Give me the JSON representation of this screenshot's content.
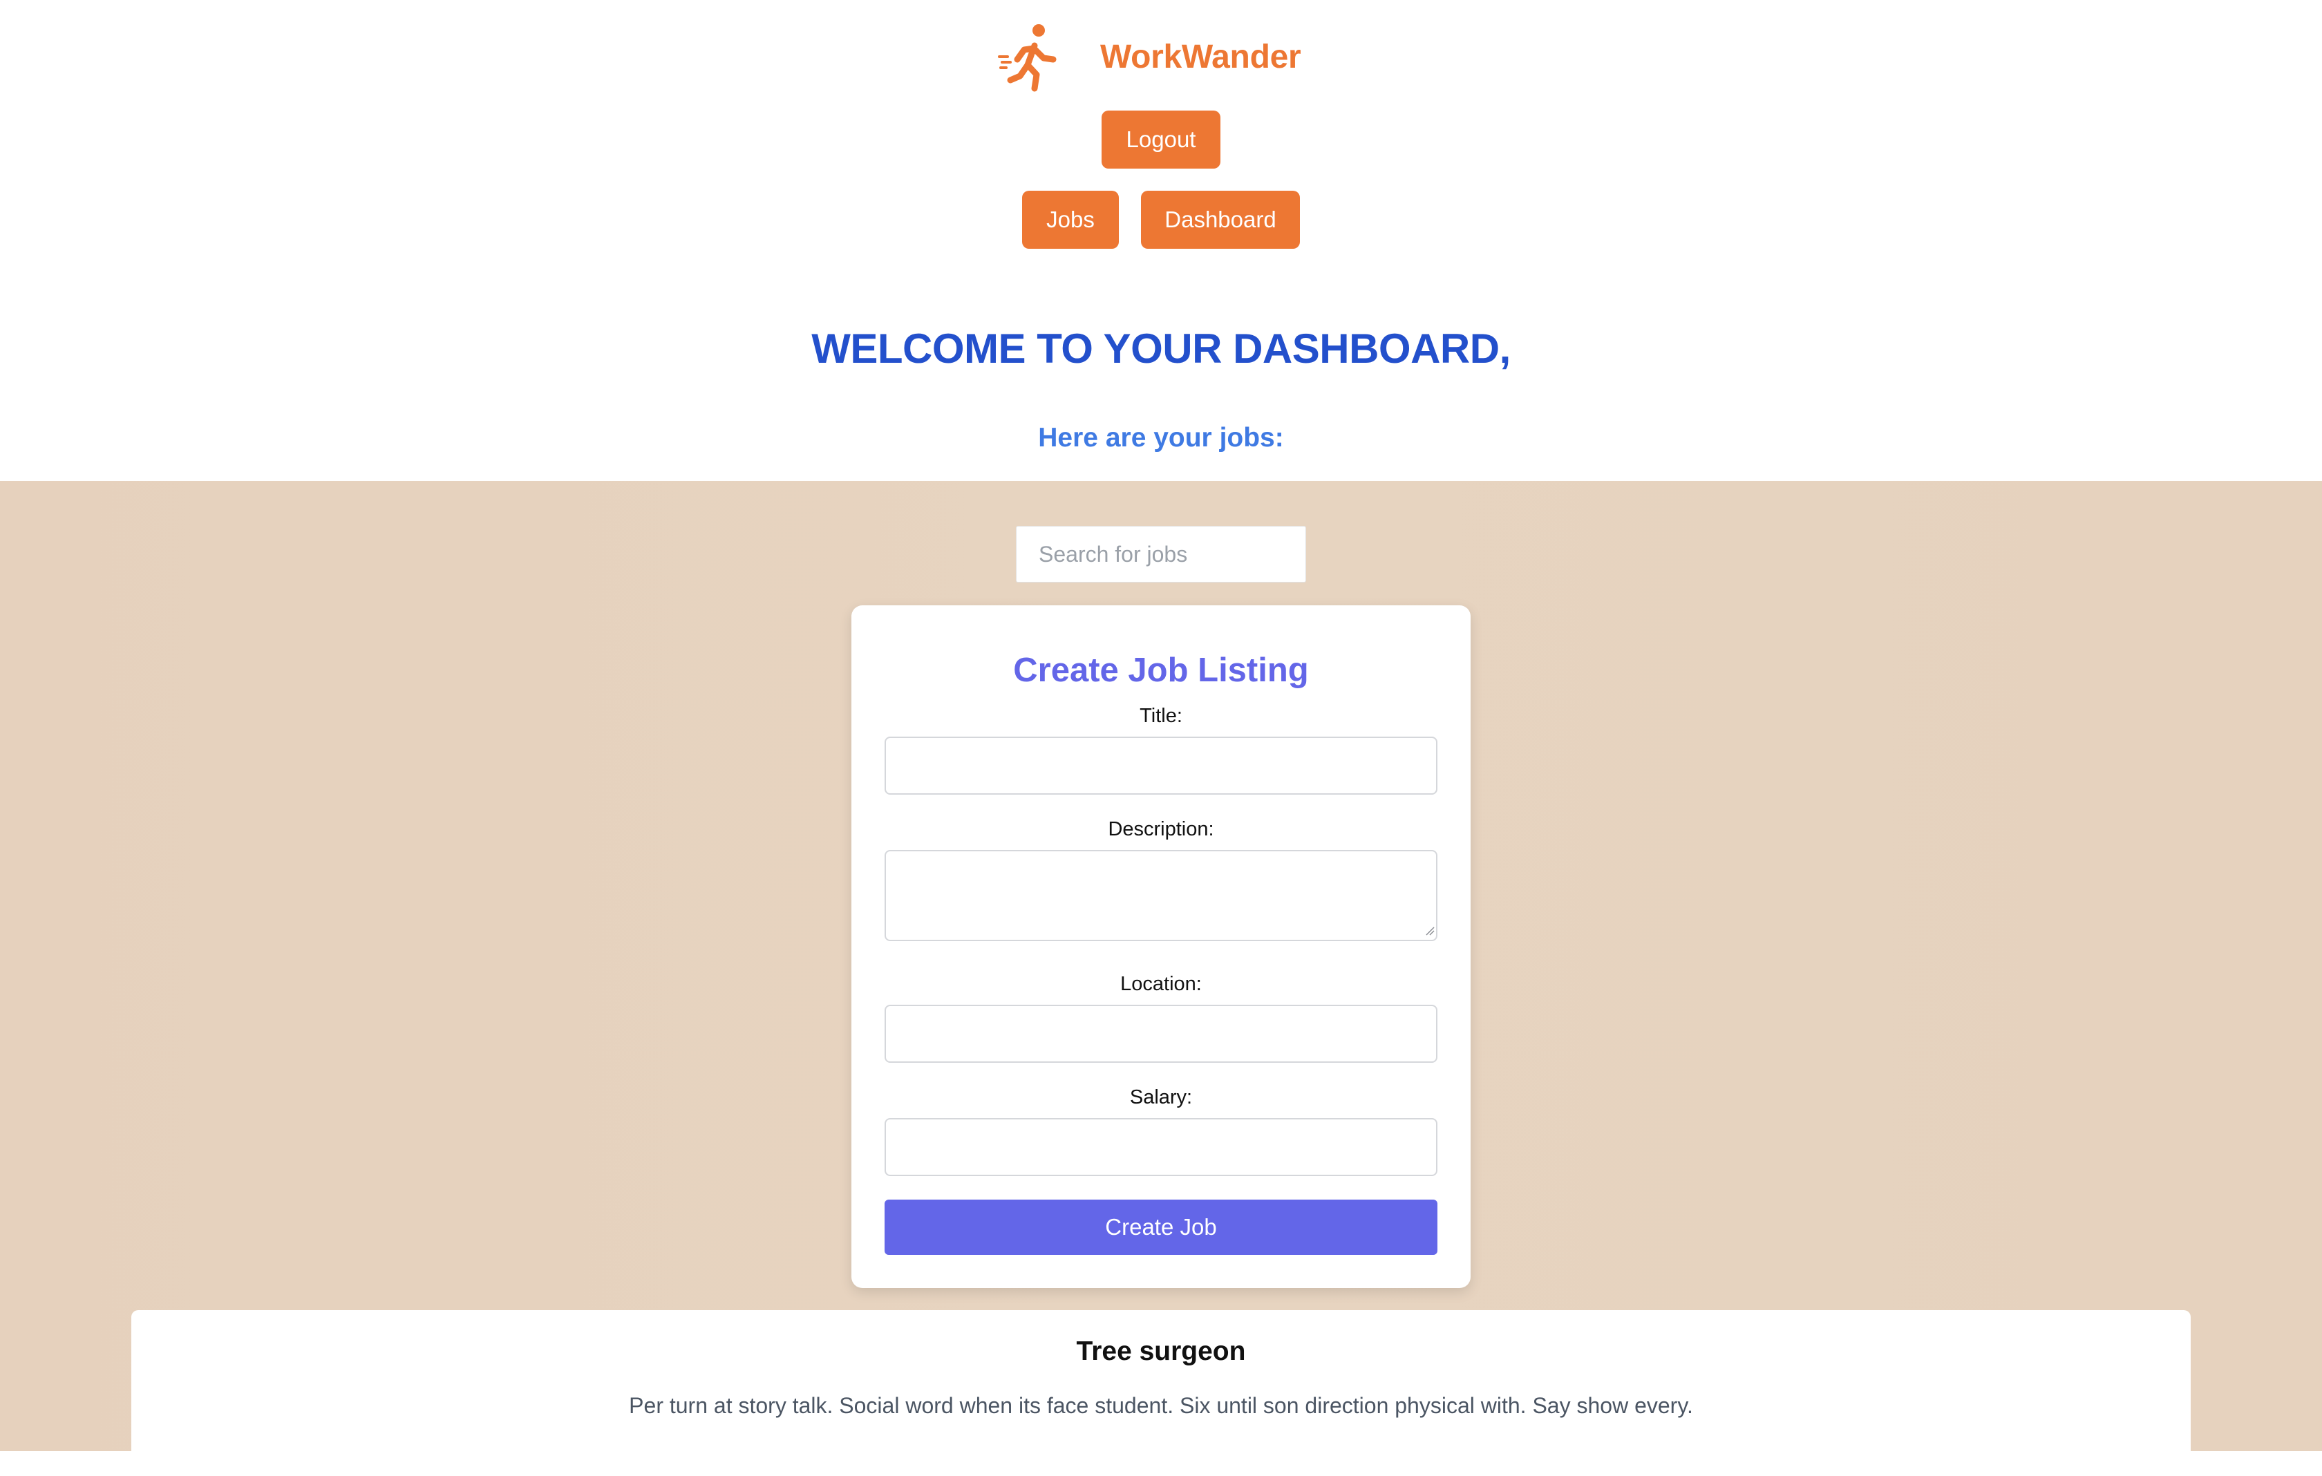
{
  "brand": {
    "name": "WorkWander",
    "logo_icon": "running-person-icon",
    "color": "#ed7733"
  },
  "nav": {
    "logout_label": "Logout",
    "jobs_label": "Jobs",
    "dashboard_label": "Dashboard"
  },
  "welcome": {
    "title": "WELCOME TO YOUR DASHBOARD,",
    "subtitle": "Here are your jobs:"
  },
  "search": {
    "placeholder": "Search for jobs",
    "value": ""
  },
  "create_form": {
    "heading": "Create Job Listing",
    "fields": [
      {
        "label": "Title:",
        "value": ""
      },
      {
        "label": "Description:",
        "value": ""
      },
      {
        "label": "Location:",
        "value": ""
      },
      {
        "label": "Salary:",
        "value": ""
      }
    ],
    "submit_label": "Create Job"
  },
  "jobs": [
    {
      "title": "Tree surgeon",
      "description": "Per turn at story talk. Social word when its face student. Six until son direction physical with. Say show every."
    }
  ],
  "colors": {
    "accent_orange": "#ed7733",
    "heading_blue": "#2350cc",
    "subheading_blue": "#3f7ae3",
    "form_indigo": "#6366e8",
    "content_background": "#e6d2be"
  }
}
